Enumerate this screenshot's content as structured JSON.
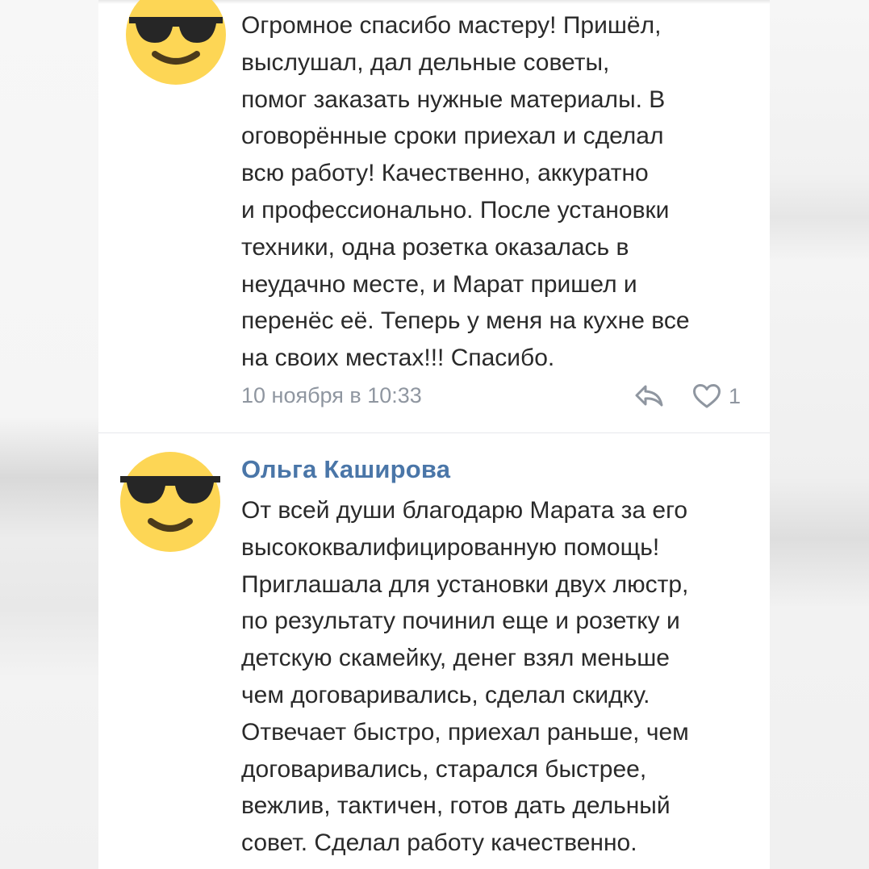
{
  "comments": [
    {
      "author": "",
      "lines": [
        "Огромное спасибо мастеру! Пришёл,",
        "выслушал, дал дельные советы,",
        "помог заказать нужные материалы. В",
        "оговорённые сроки приехал и сделал",
        "всю работу! Качественно, аккуратно",
        "и профессионально. После установки",
        "техники, одна розетка оказалась в",
        "неудачно месте, и Марат пришел и",
        "перенёс её. Теперь у меня на кухне все",
        "на своих местах!!! Спасибо."
      ],
      "date": "10 ноября в 10:33",
      "likes": "1"
    },
    {
      "author": "Ольга Каширова",
      "lines": [
        "От всей души благодарю Марата за его",
        "высококвалифицированную помощь!",
        "Приглашала для установки двух люстр,",
        "по результату починил еще и розетку и",
        "детскую скамейку, денег взял меньше",
        "чем договаривались, сделал скидку.",
        "Отвечает быстро, приехал раньше, чем",
        "договаривались, старался быстрее,",
        "вежлив, тактичен, готов дать дельный",
        "совет. Сделал работу качественно."
      ]
    }
  ],
  "icons": {
    "avatar": "sunglasses-emoji-icon",
    "reply": "reply-arrow-icon",
    "like": "heart-icon"
  },
  "colors": {
    "author_link": "#4a76a8",
    "body_text": "#2a2a2a",
    "meta_text": "#8f96a0",
    "avatar_face": "#fdd655",
    "avatar_glasses": "#262626"
  }
}
